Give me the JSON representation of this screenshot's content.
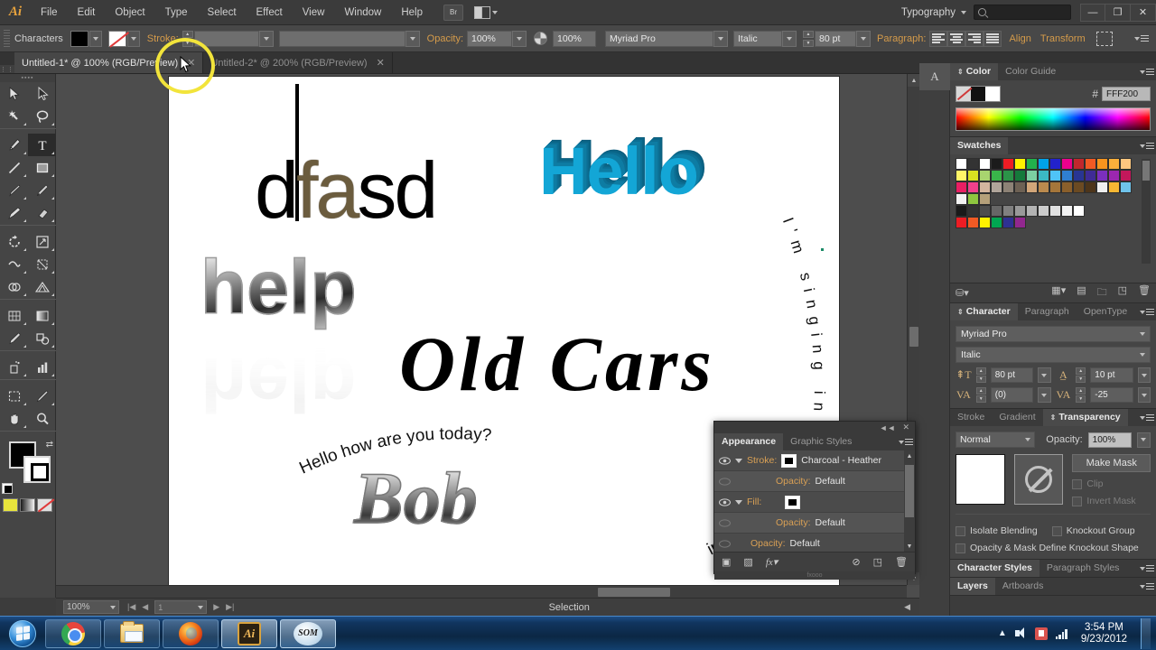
{
  "app": {
    "name": "Adobe Illustrator",
    "logo": "Ai",
    "menus": [
      "File",
      "Edit",
      "Object",
      "Type",
      "Select",
      "Effect",
      "View",
      "Window",
      "Help"
    ],
    "bridge_button": "Br",
    "workspace": "Typography",
    "search_placeholder": "",
    "window_buttons": {
      "minimize": "—",
      "restore": "❐",
      "close": "✕"
    }
  },
  "control_bar": {
    "panel_label": "Characters",
    "fill_swatch_color": "#000000",
    "stroke_swatch": "none",
    "stroke_label": "Stroke:",
    "stroke_weight": "",
    "stroke_profile": "",
    "opacity_label": "Opacity:",
    "opacity_value": "100%",
    "opacity_value2": "100%",
    "font_family": "Myriad Pro",
    "font_style": "Italic",
    "font_size": "80 pt",
    "paragraph_label": "Paragraph:",
    "align_label": "Align",
    "transform_label": "Transform",
    "accent_color": "#d59b4a"
  },
  "tabs": {
    "items": [
      {
        "label": "Untitled-1* @ 100% (RGB/Preview)",
        "active": true,
        "close": "✕"
      },
      {
        "label": "Untitled-2* @ 200% (RGB/Preview)",
        "active": false,
        "close": "✕"
      }
    ]
  },
  "toolbox": {
    "tools": [
      "selection-tool",
      "direct-selection-tool",
      "magic-wand-tool",
      "lasso-tool",
      "pen-tool",
      "type-tool",
      "line-segment-tool",
      "rectangle-tool",
      "paintbrush-tool",
      "pencil-tool",
      "blob-brush-tool",
      "eraser-tool",
      "rotate-tool",
      "scale-tool",
      "width-tool",
      "free-transform-tool",
      "shape-builder-tool",
      "perspective-grid-tool",
      "mesh-tool",
      "gradient-tool",
      "eyedropper-tool",
      "blend-tool",
      "symbol-sprayer-tool",
      "column-graph-tool",
      "artboard-tool",
      "slice-tool",
      "hand-tool",
      "zoom-tool"
    ],
    "active_tool": "type-tool",
    "fill_color": "#000000",
    "stroke_color": "#000000",
    "modes": [
      "color-mode",
      "gradient-mode",
      "none-mode"
    ]
  },
  "canvas": {
    "artwork": [
      {
        "name": "dfasd",
        "text": "dfasd"
      },
      {
        "name": "hello-3d",
        "text": "Hello",
        "color": "#13a6d6"
      },
      {
        "name": "help-chrome",
        "text": "help"
      },
      {
        "name": "old-cars",
        "text": "Old Cars"
      },
      {
        "name": "bob",
        "text": "Bob"
      },
      {
        "name": "curved-greeting",
        "text": "Hello how are you today?"
      },
      {
        "name": "curved-singing",
        "text": "I'm singing in the rain...d"
      },
      {
        "name": "curved-up",
        "text": "ing UP."
      }
    ]
  },
  "status_bar": {
    "zoom": "100%",
    "page": "1",
    "status": "Selection"
  },
  "panels": {
    "color": {
      "tabs": [
        "Color",
        "Color Guide"
      ],
      "active_tab": "Color",
      "hex_symbol": "#",
      "hex_value": "FFF200",
      "swatches": [
        "none",
        "#111111",
        "#ffffff"
      ]
    },
    "swatches": {
      "tabs": [
        "Swatches"
      ],
      "active_tab": "Swatches",
      "rows": [
        [
          "#ffffff",
          "#333333",
          "#ffffff",
          "#1b1b1b",
          "#ed1c24",
          "#fff200",
          "#22b14c",
          "#00a2e8",
          "#2222cc",
          "#ec008c",
          "#c1272d",
          "#f15a24",
          "#f7941e",
          "#fbb03b",
          "#fdc77f"
        ],
        [
          "#fff568",
          "#d9e021",
          "#a8d46f",
          "#39b54a",
          "#2b9348",
          "#157a3b",
          "#7ccfa2",
          "#3bb9c4",
          "#4fc3f7",
          "#2f7fd1",
          "#283593",
          "#3f2b96",
          "#7b2fbe",
          "#9c27b0",
          "#c2185b"
        ],
        [
          "#e91e63",
          "#f0408c",
          "#d4b59e",
          "#b0a59a",
          "#8d8276",
          "#6d6154",
          "#d2a679",
          "#bb8a4e",
          "#a5763a",
          "#8a5f2b",
          "#6b4a22",
          "#4d351a",
          "#efefef",
          "#f7b733",
          "#6fc3ea"
        ],
        [
          "#f2f2f2",
          "#8ec63f",
          "#b5a07a"
        ],
        [
          "#1a1a1a",
          "#333333",
          "#4d4d4d",
          "#666666",
          "#808080",
          "#999999",
          "#b3b3b3",
          "#cccccc",
          "#e0e0e0",
          "#f2f2f2",
          "#ffffff"
        ],
        [
          "#ed1c24",
          "#f15a24",
          "#fff200",
          "#00a651",
          "#2e3192",
          "#92278f"
        ]
      ]
    },
    "character": {
      "tabs": [
        "Character",
        "Paragraph",
        "OpenType"
      ],
      "active_tab": "Character",
      "font_family": "Myriad Pro",
      "font_style": "Italic",
      "font_size": "80 pt",
      "leading": "10 pt",
      "kerning": "(0)",
      "tracking": "-25"
    },
    "transparency": {
      "tabs": [
        "Stroke",
        "Gradient",
        "Transparency"
      ],
      "active_tab": "Transparency",
      "blend_mode": "Normal",
      "opacity_label": "Opacity:",
      "opacity_value": "100%",
      "make_mask": "Make Mask",
      "clip": "Clip",
      "invert_mask": "Invert Mask",
      "isolate_blending": "Isolate Blending",
      "knockout_group": "Knockout Group",
      "knockout_shape": "Opacity & Mask Define Knockout Shape"
    },
    "styles": {
      "tabs": [
        "Character Styles",
        "Paragraph Styles"
      ],
      "active_tab": "Character Styles"
    },
    "layers": {
      "tabs": [
        "Layers",
        "Artboards"
      ],
      "active_tab": "Layers"
    }
  },
  "appearance": {
    "tabs": [
      "Appearance",
      "Graphic Styles"
    ],
    "active_tab": "Appearance",
    "rows": [
      {
        "label": "Stroke:",
        "value": "Charcoal - Heather",
        "type": "stroke"
      },
      {
        "label": "Opacity:",
        "value": "Default",
        "type": "sub"
      },
      {
        "label": "Fill:",
        "value": "",
        "type": "fill"
      },
      {
        "label": "Opacity:",
        "value": "Default",
        "type": "sub"
      },
      {
        "label": "Opacity:",
        "value": "Default",
        "type": "base"
      }
    ],
    "collapse": "◄◄",
    "close": "✕",
    "footer_note": "fxooo"
  },
  "taskbar": {
    "items": [
      {
        "name": "start-orb",
        "label": ""
      },
      {
        "name": "chrome",
        "label": ""
      },
      {
        "name": "explorer",
        "label": ""
      },
      {
        "name": "firefox",
        "label": ""
      },
      {
        "name": "illustrator",
        "label": "Ai",
        "active": true
      },
      {
        "name": "som",
        "label": "SOM"
      }
    ],
    "clock_time": "3:54 PM",
    "clock_date": "9/23/2012"
  }
}
